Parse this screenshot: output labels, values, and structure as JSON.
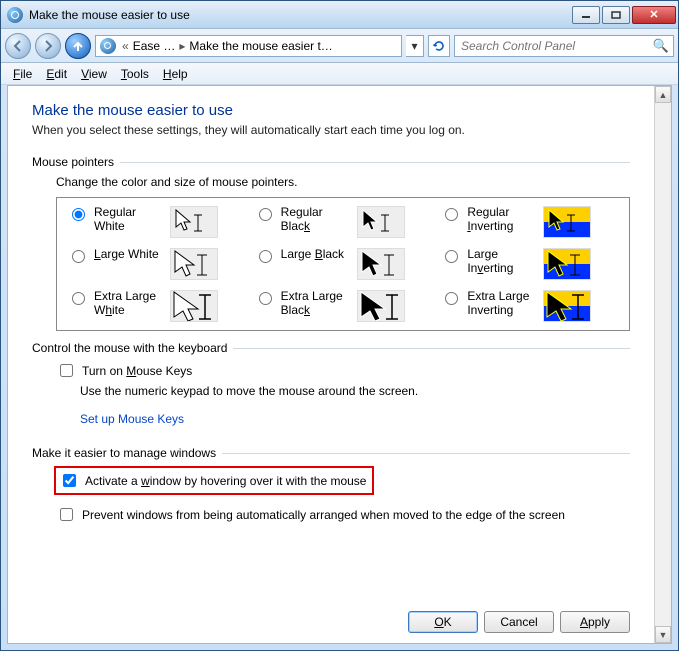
{
  "window": {
    "title": "Make the mouse easier to use"
  },
  "breadcrumb": {
    "seg1": "Ease …",
    "seg2": "Make the mouse easier t…"
  },
  "search": {
    "placeholder": "Search Control Panel"
  },
  "menu": {
    "file": "File",
    "edit": "Edit",
    "view": "View",
    "tools": "Tools",
    "help": "Help"
  },
  "main": {
    "heading": "Make the mouse easier to use",
    "subtitle": "When you select these settings, they will automatically start each time you log on."
  },
  "mouse_pointers": {
    "group_label": "Mouse pointers",
    "sub_label": "Change the color and size of mouse pointers.",
    "options": [
      {
        "label_html": "Re<u>g</u>ular White",
        "checked": true
      },
      {
        "label_html": "Regular Blac<u>k</u>",
        "checked": false
      },
      {
        "label_html": "Regular <u>I</u>nverting",
        "checked": false
      },
      {
        "label_html": "<u>L</u>arge White",
        "checked": false
      },
      {
        "label_html": "Large <u>B</u>lack",
        "checked": false
      },
      {
        "label_html": "Large In<u>v</u>erting",
        "checked": false
      },
      {
        "label_html": "Extra Large W<u>h</u>ite",
        "checked": false
      },
      {
        "label_html": "Extra Large Blac<u>k</u>",
        "checked": false,
        "k2": true
      },
      {
        "label_html": "Extra Large Inverting",
        "checked": false
      }
    ]
  },
  "keyboard": {
    "group_label": "Control the mouse with the keyboard",
    "mouse_keys_label_html": "Turn on <u>M</u>ouse Keys",
    "mouse_keys_checked": false,
    "helper": "Use the numeric keypad to move the mouse around the screen.",
    "link": "Set up Mouse Keys"
  },
  "windows": {
    "group_label": "Make it easier to manage windows",
    "activate_label_html": "Activate a <u>w</u>indow by hovering over it with the mouse",
    "activate_checked": true,
    "prevent_label": "Prevent windows from being automatically arranged when moved to the edge of the screen",
    "prevent_checked": false
  },
  "buttons": {
    "ok": "OK",
    "cancel": "Cancel",
    "apply": "Apply"
  }
}
